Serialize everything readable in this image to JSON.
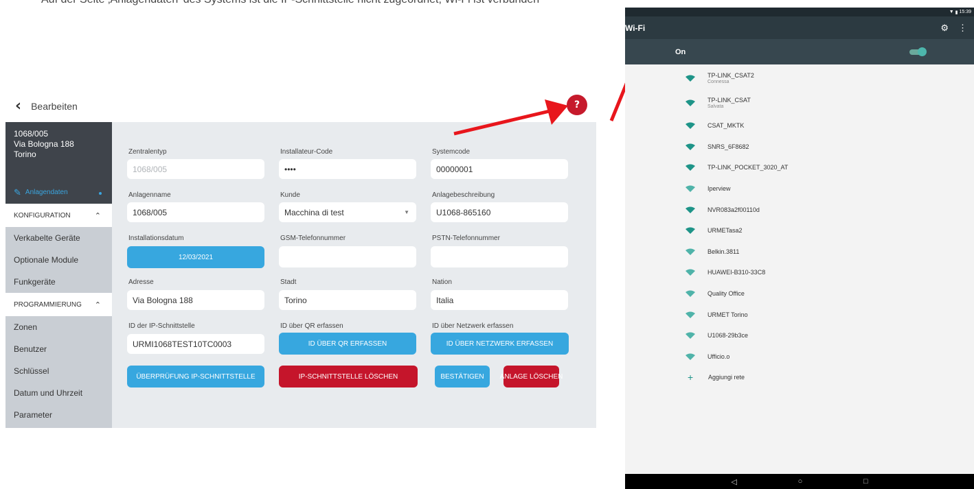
{
  "top_text": "Auf der Seite ‚Anlagendaten' des Systems ist die IP-Schnittstelle nicht zugeordnet; Wi-Fi ist verbunden",
  "app": {
    "title": "Bearbeiten",
    "sidebar": {
      "device_id": "1068/005",
      "address_line1": "Via Bologna 188",
      "address_line2": "Torino",
      "active_item": "Anlagendaten",
      "sections": [
        {
          "label": "KONFIGURATION",
          "items": [
            "Verkabelte Geräte",
            "Optionale Module",
            "Funkgeräte"
          ]
        },
        {
          "label": "PROGRAMMIERUNG",
          "items": [
            "Zonen",
            "Benutzer",
            "Schlüssel",
            "Datum und Uhrzeit",
            "Parameter"
          ]
        }
      ]
    },
    "form": {
      "zentralentyp_label": "Zentralentyp",
      "zentralentyp_value": "1068/005",
      "installateur_label": "Installateur-Code",
      "installateur_value": "••••",
      "systemcode_label": "Systemcode",
      "systemcode_value": "00000001",
      "anlagenname_label": "Anlagenname",
      "anlagenname_value": "1068/005",
      "kunde_label": "Kunde",
      "kunde_value": "Macchina di test",
      "beschreibung_label": "Anlagebeschreibung",
      "beschreibung_value": "U1068-865160",
      "installationsdatum_label": "Installationsdatum",
      "installationsdatum_value": "12/03/2021",
      "gsm_label": "GSM-Telefonnummer",
      "gsm_value": "",
      "pstn_label": "PSTN-Telefonnummer",
      "pstn_value": "",
      "adresse_label": "Adresse",
      "adresse_value": "Via Bologna 188",
      "stadt_label": "Stadt",
      "stadt_value": "Torino",
      "nation_label": "Nation",
      "nation_value": "Italia",
      "ip_label": "ID der IP-Schnittstelle",
      "ip_value": "URMI1068TEST10TC0003",
      "qr_label": "ID über QR erfassen",
      "qr_button": "ID ÜBER QR ERFASSEN",
      "netz_label": "ID über Netzwerk erfassen",
      "netz_button": "ID ÜBER NETZWERK ERFASSEN",
      "check_button": "ÜBERPRÜFUNG IP-SCHNITTSTELLE",
      "delete_ip_button": "IP-SCHNITTSTELLE LÖSCHEN",
      "confirm_button": "BESTÄTIGEN",
      "delete_system_button": "ANLAGE LÖSCHEN"
    }
  },
  "android": {
    "status_time": "15:39",
    "toolbar_title": "Wi-Fi",
    "on_label": "On",
    "networks": [
      {
        "name": "TP-LINK_CSAT2",
        "sub": "Connessa"
      },
      {
        "name": "TP-LINK_CSAT",
        "sub": "Salvata"
      },
      {
        "name": "CSAT_MKTK",
        "sub": ""
      },
      {
        "name": "SNRS_6F8682",
        "sub": ""
      },
      {
        "name": "TP-LINK_POCKET_3020_AT",
        "sub": ""
      },
      {
        "name": "Iperview",
        "sub": ""
      },
      {
        "name": "NVR083a2f00110d",
        "sub": ""
      },
      {
        "name": "URMETasa2",
        "sub": ""
      },
      {
        "name": "Belkin.3811",
        "sub": ""
      },
      {
        "name": "HUAWEI-B310-33C8",
        "sub": ""
      },
      {
        "name": "Quality Office",
        "sub": ""
      },
      {
        "name": "URMET Torino",
        "sub": ""
      },
      {
        "name": "U1068-29b3ce",
        "sub": ""
      },
      {
        "name": "Ufficio.o",
        "sub": ""
      }
    ],
    "add_network": "Aggiungi rete"
  },
  "colors": {
    "sidebar_dark": "#3f444b",
    "accent_blue": "#37a7df",
    "danger_red": "#c5152b",
    "arrow_red": "#e8161c",
    "android_toolbar": "#2c3a41",
    "wifi_teal": "#1e9488"
  }
}
